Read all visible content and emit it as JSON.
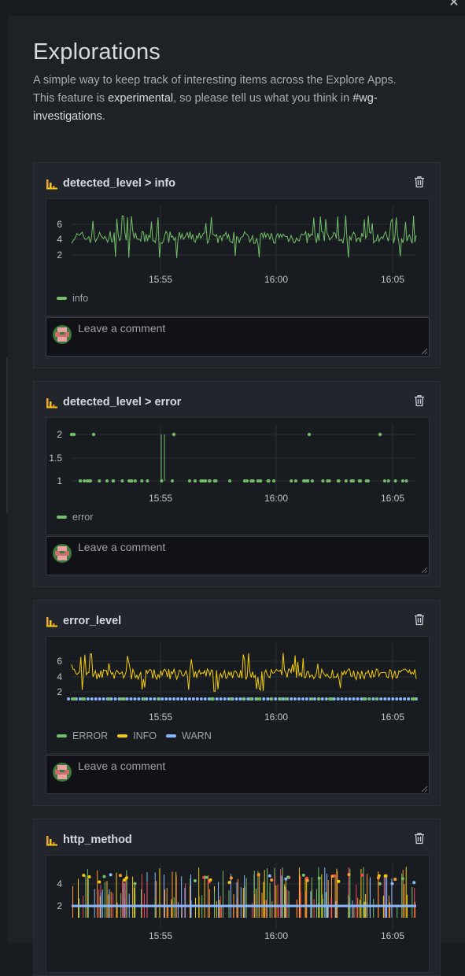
{
  "header": {
    "title": "Explorations",
    "desc_line1": "A simple way to keep track of interesting items across the Explore Apps.",
    "desc_pre": "This feature is ",
    "desc_em": "experimental",
    "desc_mid": ", so please tell us what you think in ",
    "desc_link_1": "#wg-",
    "desc_link_2": "investigations",
    "desc_end": ".",
    "close_icon": "close-icon"
  },
  "colors": {
    "green": "#73bf69",
    "yellow": "#f2cc0c",
    "blue": "#8ab8ff",
    "red": "#f2495c",
    "orange": "#ff9830",
    "grid": "#2a2d33"
  },
  "comment_placeholder": "Leave a comment",
  "cards": [
    {
      "title": "detected_level > info",
      "icon": "explore-logs-icon",
      "trash_icon": "trash-icon",
      "y_ticks": [
        "6",
        "4",
        "2"
      ],
      "x_ticks": [
        "15:55",
        "16:00",
        "16:05"
      ],
      "legend": [
        {
          "label": "info",
          "color": "#73bf69"
        }
      ]
    },
    {
      "title": "detected_level > error",
      "icon": "explore-logs-icon",
      "trash_icon": "trash-icon",
      "y_ticks": [
        "2",
        "1.5",
        "1"
      ],
      "x_ticks": [
        "15:55",
        "16:00",
        "16:05"
      ],
      "legend": [
        {
          "label": "error",
          "color": "#73bf69"
        }
      ]
    },
    {
      "title": "error_level",
      "icon": "explore-logs-icon",
      "trash_icon": "trash-icon",
      "y_ticks": [
        "6",
        "4",
        "2"
      ],
      "x_ticks": [
        "15:55",
        "16:00",
        "16:05"
      ],
      "legend": [
        {
          "label": "ERROR",
          "color": "#73bf69"
        },
        {
          "label": "INFO",
          "color": "#f2cc0c"
        },
        {
          "label": "WARN",
          "color": "#8ab8ff"
        }
      ]
    },
    {
      "title": "http_method",
      "icon": "explore-logs-icon",
      "trash_icon": "trash-icon",
      "y_ticks": [
        "4",
        "2"
      ],
      "x_ticks": [
        "15:55",
        "16:00",
        "16:05"
      ],
      "legend": []
    }
  ],
  "chart_data": [
    {
      "type": "line",
      "series": [
        {
          "name": "info",
          "values_approx": "fluctuating between 2 and 7, mostly around 4"
        }
      ],
      "x_ticks": [
        "15:55",
        "16:00",
        "16:05"
      ],
      "ylim": [
        1,
        7
      ]
    },
    {
      "type": "scatter",
      "series": [
        {
          "name": "error",
          "values_approx": "mostly 1, occasional 2"
        }
      ],
      "x_ticks": [
        "15:55",
        "16:00",
        "16:05"
      ],
      "ylim": [
        1,
        2
      ]
    },
    {
      "type": "line",
      "series": [
        {
          "name": "ERROR",
          "values_approx": "mostly 1"
        },
        {
          "name": "INFO",
          "values_approx": "fluctuating between 3 and 7"
        },
        {
          "name": "WARN",
          "values_approx": "mostly 1"
        }
      ],
      "x_ticks": [
        "15:55",
        "16:00",
        "16:05"
      ],
      "ylim": [
        1,
        7
      ]
    },
    {
      "type": "line",
      "series": [
        {
          "values_approx": "multiple series mostly around 2, spikes up to 5"
        }
      ],
      "x_ticks": [
        "15:55",
        "16:00",
        "16:05"
      ],
      "ylim": [
        1,
        5
      ]
    }
  ]
}
